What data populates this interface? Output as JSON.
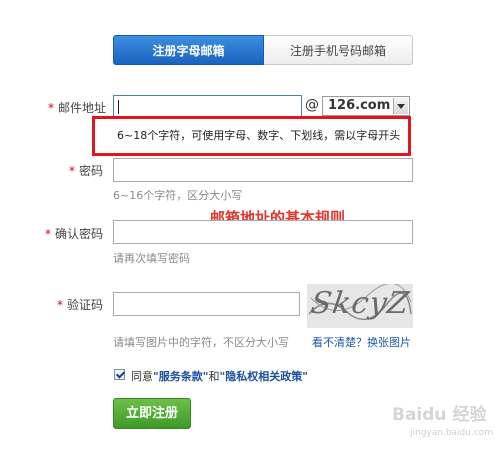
{
  "tabs": {
    "active": "注册字母邮箱",
    "inactive": "注册手机号码邮箱"
  },
  "required_mark": "*",
  "email": {
    "label": "邮件地址",
    "value": "",
    "at": "@",
    "domain": "126.com",
    "rule_text": "6~18个字符，可使用字母、数字、下划线，需以字母开头"
  },
  "password": {
    "label": "密码",
    "hint": "6~16个字符，区分大小写"
  },
  "annotation": "邮箱地址的基本规则",
  "confirm": {
    "label": "确认密码",
    "hint": "请再次填写密码"
  },
  "captcha": {
    "label": "验证码",
    "hint": "请填写图片中的字符，不区分大小写",
    "image_text": "SkcyZ",
    "refresh_link": "看不清楚？换张图片"
  },
  "agree": {
    "prefix": "同意",
    "terms": "\"服务条款\"",
    "and": "和",
    "privacy": "\"隐私权相关政策\""
  },
  "submit_label": "立即注册",
  "watermark": {
    "main": "Baidu 经验",
    "sub": "jingyan.baidu.com"
  }
}
